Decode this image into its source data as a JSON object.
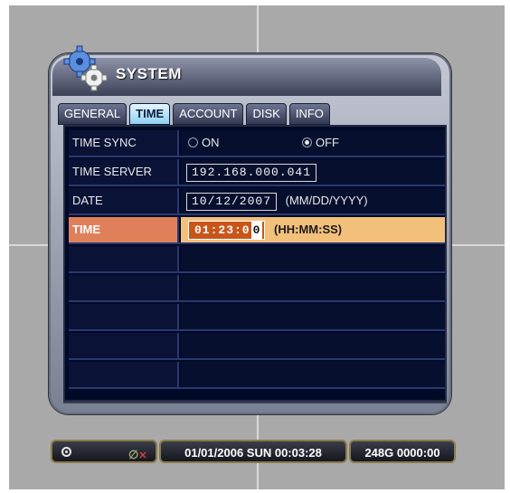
{
  "dialog": {
    "title": "SYSTEM",
    "icon": "gears-icon"
  },
  "tabs": [
    {
      "label": "GENERAL",
      "active": false
    },
    {
      "label": "TIME",
      "active": true
    },
    {
      "label": "ACCOUNT",
      "active": false
    },
    {
      "label": "DISK",
      "active": false
    },
    {
      "label": "INFO",
      "active": false
    }
  ],
  "rows": {
    "time_sync": {
      "label": "TIME SYNC",
      "on_label": "ON",
      "off_label": "OFF",
      "selected": "OFF"
    },
    "time_server": {
      "label": "TIME SERVER",
      "value": "192.168.000.041"
    },
    "date": {
      "label": "DATE",
      "value": "10/12/2007",
      "format": "(MM/DD/YYYY)"
    },
    "time": {
      "label": "TIME",
      "value_prefix": "01:23:0",
      "value_cursor": "0",
      "format": "(HH:MM:SS)"
    }
  },
  "status_bar": {
    "datetime": "01/01/2006 SUN 00:03:28",
    "disk": "248G  0000:00",
    "icons": [
      "record-icon",
      "audio-mute-icon"
    ]
  },
  "colors": {
    "highlight_label": "#e0805a",
    "highlight_value": "#f3c07c",
    "table_bg": "#000a26",
    "active_tab": "#8fd0f0"
  }
}
